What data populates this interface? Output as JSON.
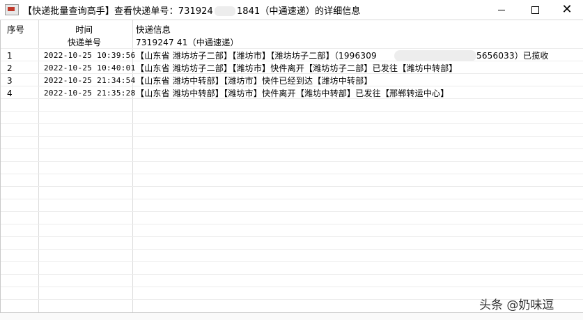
{
  "window": {
    "title_prefix": "【快递批量查询高手】查看快递单号：731924",
    "title_suffix": "1841（中通速递）的详细信息",
    "minimize": "—",
    "maximize": "□",
    "close": "✕"
  },
  "table": {
    "headers": {
      "seq": "序号",
      "time": "时间",
      "info": "快递信息"
    },
    "subheader": {
      "label": "快递单号",
      "value": "7319247      41（中通速递）"
    },
    "rows": [
      {
        "seq": "1",
        "time": "2022-10-25 10:39:56",
        "info": "【山东省 潍坊坊子二部】【潍坊市】【潍坊坊子二部】（1996309",
        "info_tail": "5656033）已揽收"
      },
      {
        "seq": "2",
        "time": "2022-10-25 10:40:01",
        "info": "【山东省 潍坊坊子二部】【潍坊市】快件离开【潍坊坊子二部】已发往【潍坊中转部】",
        "info_tail": ""
      },
      {
        "seq": "3",
        "time": "2022-10-25 21:34:54",
        "info": "【山东省 潍坊中转部】【潍坊市】快件已经到达【潍坊中转部】",
        "info_tail": ""
      },
      {
        "seq": "4",
        "time": "2022-10-25 21:35:28",
        "info": "【山东省 潍坊中转部】【潍坊市】快件离开【潍坊中转部】已发往【邢郸转运中心】",
        "info_tail": ""
      }
    ]
  },
  "watermark": "头条 @奶味逗"
}
